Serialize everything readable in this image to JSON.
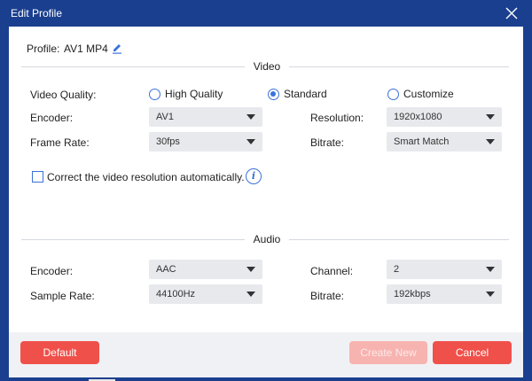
{
  "window": {
    "title": "Edit Profile"
  },
  "profile": {
    "label": "Profile:",
    "value": "AV1 MP4"
  },
  "video": {
    "section_title": "Video",
    "quality_label": "Video Quality:",
    "quality_options": [
      {
        "label": "High Quality",
        "selected": false
      },
      {
        "label": "Standard",
        "selected": true
      },
      {
        "label": "Customize",
        "selected": false
      }
    ],
    "encoder_label": "Encoder:",
    "encoder_value": "AV1",
    "resolution_label": "Resolution:",
    "resolution_value": "1920x1080",
    "frame_rate_label": "Frame Rate:",
    "frame_rate_value": "30fps",
    "bitrate_label": "Bitrate:",
    "bitrate_value": "Smart Match",
    "auto_resolution_label": "Correct the video resolution automatically.",
    "auto_resolution_checked": false
  },
  "audio": {
    "section_title": "Audio",
    "encoder_label": "Encoder:",
    "encoder_value": "AAC",
    "channel_label": "Channel:",
    "channel_value": "2",
    "sample_rate_label": "Sample Rate:",
    "sample_rate_value": "44100Hz",
    "bitrate_label": "Bitrate:",
    "bitrate_value": "192kbps"
  },
  "buttons": {
    "default_label": "Default",
    "create_new_label": "Create New",
    "cancel_label": "Cancel"
  },
  "colors": {
    "title_bar": "#1b3f8f",
    "accent": "#3a72d8",
    "button_red": "#f0504a",
    "button_disabled": "#f7b3b0"
  }
}
